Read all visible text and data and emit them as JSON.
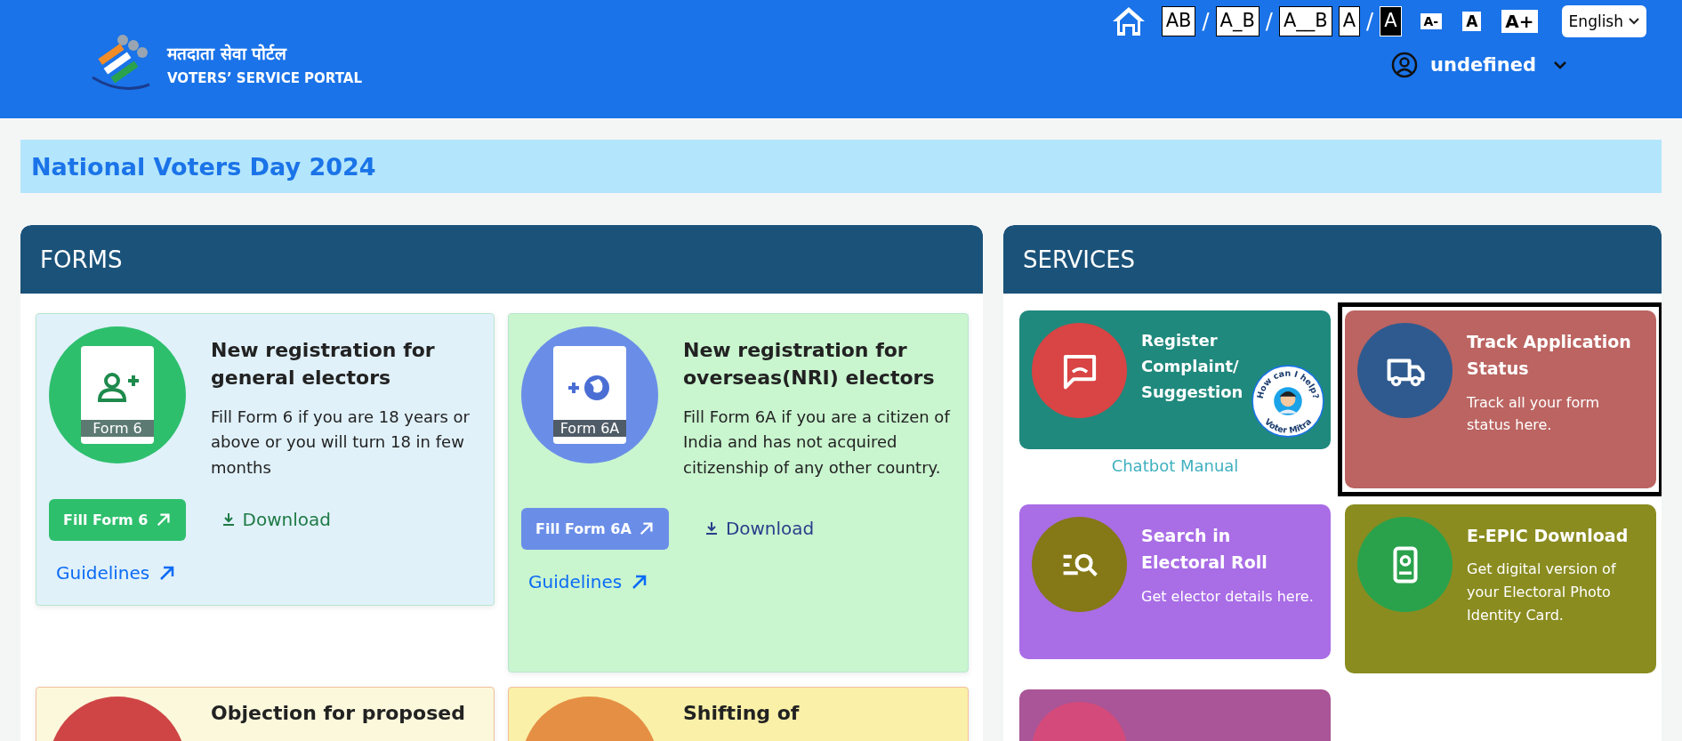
{
  "header": {
    "logo_hindi": "मतदाता सेवा पोर्टल",
    "logo_english": "VOTERS’ SERVICE PORTAL",
    "toolbar": [
      {
        "kind": "spacing",
        "label": "AB"
      },
      {
        "kind": "slash",
        "label": "/"
      },
      {
        "kind": "spacing",
        "label": "A_B"
      },
      {
        "kind": "slash",
        "label": "/"
      },
      {
        "kind": "spacing",
        "label": "A__B"
      },
      {
        "kind": "contrast-light",
        "label": "A"
      },
      {
        "kind": "slash",
        "label": "/"
      },
      {
        "kind": "contrast-dark",
        "label": "A"
      },
      {
        "kind": "size-small",
        "label": "A-"
      },
      {
        "kind": "size-normal",
        "label": "A"
      },
      {
        "kind": "size-large",
        "label": "A+"
      }
    ],
    "language": "English",
    "user": "undefined"
  },
  "banner": "National Voters Day 2024",
  "forms": {
    "title": "FORMS",
    "cards": [
      {
        "title": "New registration for general electors",
        "description": "Fill Form 6 if you are 18 years or above or you will turn 18 in few months",
        "icon_label": "Form 6",
        "kind": "person-add",
        "color": "#2ebf6d",
        "fill_button": "Fill Form 6",
        "download": "Download",
        "guidelines": "Guidelines"
      },
      {
        "title": "New registration for overseas(NRI) electors",
        "description": "Fill Form 6A if you are a citizen of India and has not acquired citizenship of any other country.",
        "icon_label": "Form 6A",
        "kind": "globe-add",
        "color": "#6a8ee8",
        "fill_button": "Fill Form 6A",
        "download": "Download",
        "guidelines": "Guidelines"
      },
      {
        "title": "Objection for proposed",
        "color": "#cf4545"
      },
      {
        "title": "Shifting of",
        "color": "#e58f45"
      }
    ]
  },
  "services": {
    "title": "SERVICES",
    "cards": [
      {
        "kind": "complaint",
        "title": "Register Complaint/ Suggestion",
        "color": "#d94444",
        "selected": false,
        "link": "Chatbot Manual"
      },
      {
        "kind": "truck",
        "title": "Track Application Status",
        "description": "Track all your form status here.",
        "color": "#2f5a8f",
        "selected": true
      },
      {
        "kind": "search",
        "title": "Search in Electoral Roll",
        "description": "Get elector details here.",
        "color": "#857817",
        "selected": false
      },
      {
        "kind": "id-card",
        "title": "E-EPIC Download",
        "description": "Get digital version of your Electoral Photo Identity Card.",
        "color": "#2aa24c",
        "selected": false
      },
      {
        "kind": "partial",
        "color": "#d44a7a",
        "selected": false
      }
    ]
  },
  "chatbot": {
    "top_text": "How can I help?",
    "bottom_text": "Voter Mitra"
  }
}
